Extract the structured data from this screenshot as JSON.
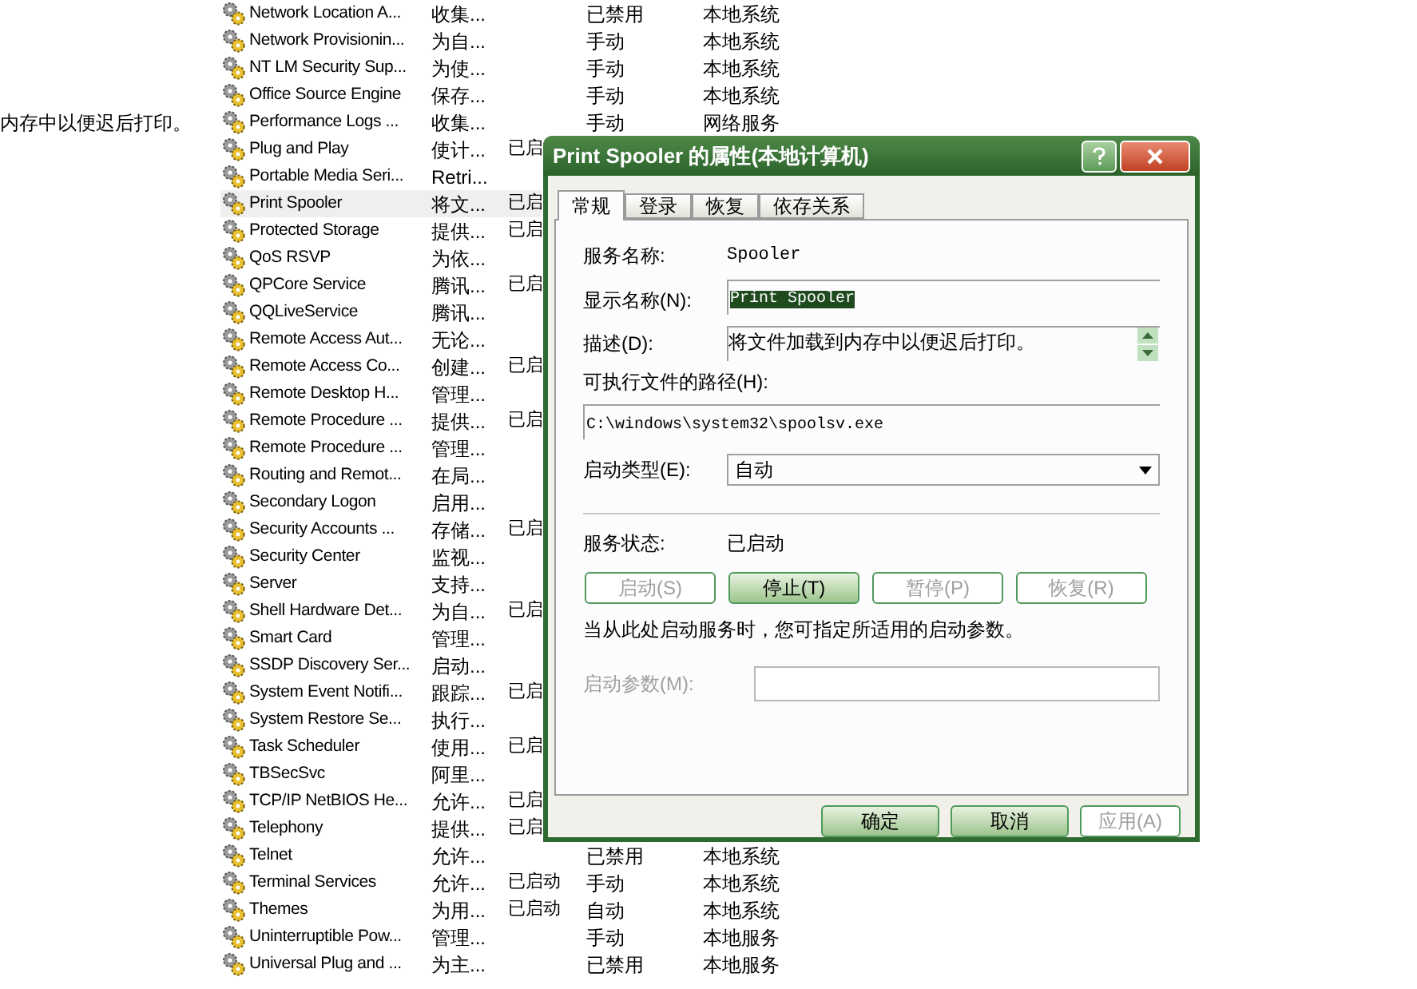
{
  "background_text": "内存中以便迟后打印。",
  "services": {
    "rows": [
      {
        "name": "Network Location A...",
        "description": "收集...",
        "status": "",
        "startup": "已禁用",
        "logon": "本地系统",
        "selected": false
      },
      {
        "name": "Network Provisionin...",
        "description": "为自...",
        "status": "",
        "startup": "手动",
        "logon": "本地系统",
        "selected": false
      },
      {
        "name": "NT LM Security Sup...",
        "description": "为使...",
        "status": "",
        "startup": "手动",
        "logon": "本地系统",
        "selected": false
      },
      {
        "name": "Office Source Engine",
        "description": "保存...",
        "status": "",
        "startup": "手动",
        "logon": "本地系统",
        "selected": false
      },
      {
        "name": "Performance Logs ...",
        "description": "收集...",
        "status": "",
        "startup": "手动",
        "logon": "网络服务",
        "selected": false
      },
      {
        "name": "Plug and Play",
        "description": "使计...",
        "status": "已启",
        "selected": false
      },
      {
        "name": "Portable Media Seri...",
        "description": "Retri...",
        "status": "",
        "selected": false
      },
      {
        "name": "Print Spooler",
        "description": "将文...",
        "status": "已启",
        "selected": true
      },
      {
        "name": "Protected Storage",
        "description": "提供...",
        "status": "已启",
        "selected": false
      },
      {
        "name": "QoS RSVP",
        "description": "为依...",
        "status": "",
        "selected": false
      },
      {
        "name": "QPCore Service",
        "description": "腾讯...",
        "status": "已启",
        "selected": false
      },
      {
        "name": "QQLiveService",
        "description": "腾讯...",
        "status": "",
        "selected": false
      },
      {
        "name": "Remote Access Aut...",
        "description": "无论...",
        "status": "",
        "selected": false
      },
      {
        "name": "Remote Access Co...",
        "description": "创建...",
        "status": "已启",
        "selected": false
      },
      {
        "name": "Remote Desktop H...",
        "description": "管理...",
        "status": "",
        "selected": false
      },
      {
        "name": "Remote Procedure ...",
        "description": "提供...",
        "status": "已启",
        "selected": false
      },
      {
        "name": "Remote Procedure ...",
        "description": "管理...",
        "status": "",
        "selected": false
      },
      {
        "name": "Routing and Remot...",
        "description": "在局...",
        "status": "",
        "selected": false
      },
      {
        "name": "Secondary Logon",
        "description": "启用...",
        "status": "",
        "selected": false
      },
      {
        "name": "Security Accounts ...",
        "description": "存储...",
        "status": "已启",
        "selected": false
      },
      {
        "name": "Security Center",
        "description": "监视...",
        "status": "",
        "selected": false
      },
      {
        "name": "Server",
        "description": "支持...",
        "status": "",
        "selected": false
      },
      {
        "name": "Shell Hardware Det...",
        "description": "为自...",
        "status": "已启",
        "selected": false
      },
      {
        "name": "Smart Card",
        "description": "管理...",
        "status": "",
        "selected": false
      },
      {
        "name": "SSDP Discovery Ser...",
        "description": "启动...",
        "status": "",
        "selected": false
      },
      {
        "name": "System Event Notifi...",
        "description": "跟踪...",
        "status": "已启",
        "selected": false
      },
      {
        "name": "System Restore Se...",
        "description": "执行...",
        "status": "",
        "selected": false
      },
      {
        "name": "Task Scheduler",
        "description": "使用...",
        "status": "已启",
        "selected": false
      },
      {
        "name": "TBSecSvc",
        "description": "阿里...",
        "status": "",
        "selected": false
      },
      {
        "name": "TCP/IP NetBIOS He...",
        "description": "允许...",
        "status": "已启",
        "selected": false
      },
      {
        "name": "Telephony",
        "description": "提供...",
        "status": "已启",
        "selected": false
      },
      {
        "name": "Telnet",
        "description": "允许...",
        "status": "",
        "startup": "已禁用",
        "logon": "本地系统",
        "selected": false
      },
      {
        "name": "Terminal Services",
        "description": "允许...",
        "status": "已启动",
        "startup": "手动",
        "logon": "本地系统",
        "selected": false
      },
      {
        "name": "Themes",
        "description": "为用...",
        "status": "已启动",
        "startup": "自动",
        "logon": "本地系统",
        "selected": false
      },
      {
        "name": "Uninterruptible Pow...",
        "description": "管理...",
        "status": "",
        "startup": "手动",
        "logon": "本地服务",
        "selected": false
      },
      {
        "name": "Universal Plug and ...",
        "description": "为主...",
        "status": "",
        "startup": "已禁用",
        "logon": "本地服务",
        "selected": false
      }
    ]
  },
  "dialog": {
    "title": "Print Spooler 的属性(本地计算机)",
    "tabs": [
      {
        "label": "常规",
        "selected": true
      },
      {
        "label": "登录",
        "selected": false
      },
      {
        "label": "恢复",
        "selected": false
      },
      {
        "label": "依存关系",
        "selected": false
      }
    ],
    "service_name": {
      "label": "服务名称:",
      "value": "Spooler"
    },
    "display_name": {
      "label": "显示名称(N):",
      "value": "Print Spooler",
      "highlighted": true
    },
    "description": {
      "label": "描述(D):",
      "value": "将文件加载到内存中以便迟后打印。"
    },
    "path": {
      "label": "可执行文件的路径(H):",
      "value": "C:\\windows\\system32\\spoolsv.exe"
    },
    "startup_type": {
      "label": "启动类型(E):",
      "value": "自动"
    },
    "service_status": {
      "label": "服务状态:",
      "value": "已启动"
    },
    "control_buttons": [
      {
        "label": "启动(S)",
        "disabled": true
      },
      {
        "label": "停止(T)",
        "disabled": false
      },
      {
        "label": "暂停(P)",
        "disabled": true
      },
      {
        "label": "恢复(R)",
        "disabled": true
      }
    ],
    "note": "当从此处启动服务时，您可指定所适用的启动参数。",
    "start_params": {
      "label": "启动参数(M):",
      "disabled": true
    },
    "footer_buttons": [
      {
        "label": "确定",
        "disabled": false
      },
      {
        "label": "取消",
        "disabled": false
      },
      {
        "label": "应用(A)",
        "disabled": true
      }
    ]
  }
}
